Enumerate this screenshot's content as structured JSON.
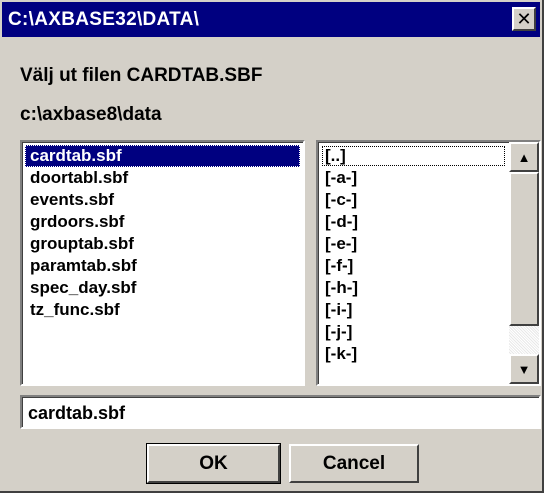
{
  "window": {
    "title": "C:\\AXBASE32\\DATA\\",
    "close_label": "✕"
  },
  "dialog": {
    "prompt": "Välj ut filen CARDTAB.SBF",
    "current_path": "c:\\axbase8\\data"
  },
  "file_list": {
    "selected": "cardtab.sbf",
    "items": [
      "cardtab.sbf",
      "doortabl.sbf",
      "events.sbf",
      "grdoors.sbf",
      "grouptab.sbf",
      "paramtab.sbf",
      "spec_day.sbf",
      "tz_func.sbf"
    ]
  },
  "dir_list": {
    "items": [
      "[..]",
      "[-a-]",
      "[-c-]",
      "[-d-]",
      "[-e-]",
      "[-f-]",
      "[-h-]",
      "[-i-]",
      "[-j-]",
      "[-k-]"
    ],
    "up_icon": "arrow-up-icon",
    "down_icon": "arrow-down-icon"
  },
  "filename_input": {
    "value": "cardtab.sbf"
  },
  "buttons": {
    "ok_label": "OK",
    "cancel_label": "Cancel"
  },
  "colors": {
    "titlebar": "#000080",
    "face": "#d4d0c8",
    "selection": "#000080"
  }
}
